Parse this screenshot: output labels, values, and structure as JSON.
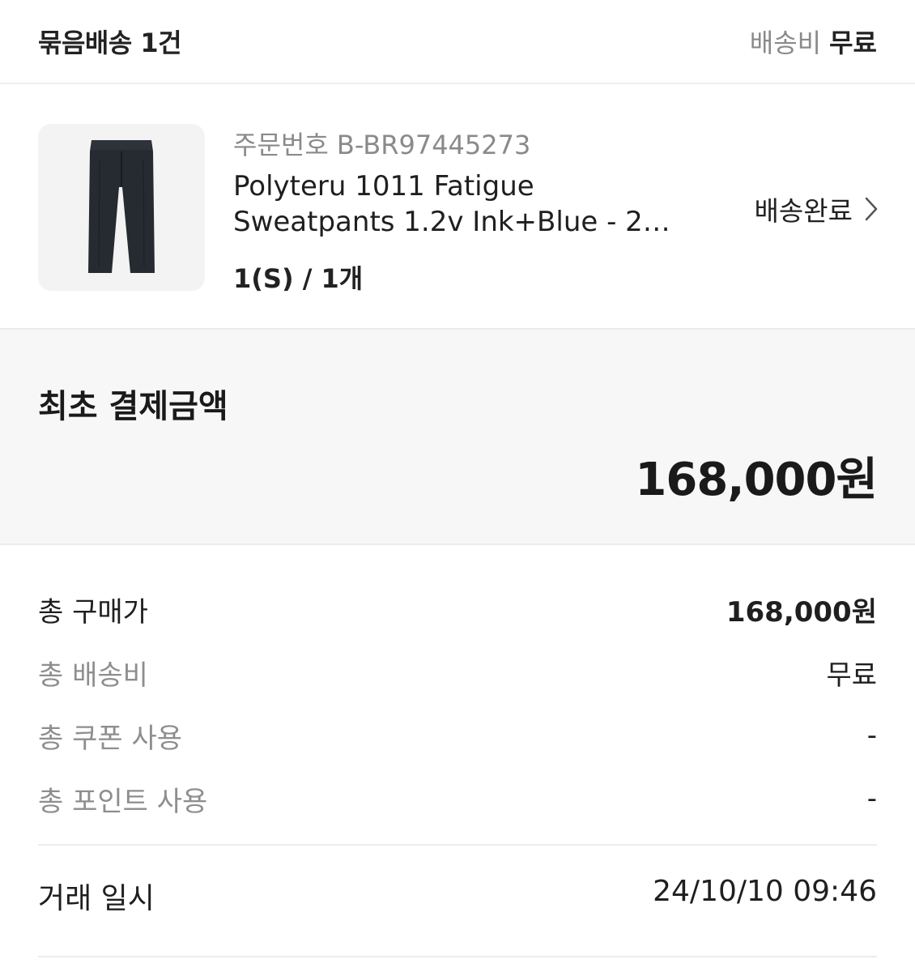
{
  "bundle": {
    "title": "묶음배송 1건",
    "shipping_label": "배송비",
    "shipping_value": "무료"
  },
  "item": {
    "order_number": "주문번호 B-BR97445273",
    "name_line1": "Polyteru 1011 Fatigue",
    "name_line2": "Sweatpants 1.2v Ink+Blue - 2…",
    "option": "1(S) / 1개",
    "status": "배송완료",
    "thumbnail_icon": "pants-image"
  },
  "payment": {
    "title": "최초 결제금액",
    "amount": "168,000원"
  },
  "summary": [
    {
      "key": "총 구매가",
      "value": "168,000원"
    },
    {
      "key": "총 배송비",
      "value": "무료"
    },
    {
      "key": "총 쿠폰 사용",
      "value": "-"
    },
    {
      "key": "총 포인트 사용",
      "value": "-"
    }
  ],
  "transaction": {
    "label": "거래 일시",
    "value": "24/10/10 09:46"
  }
}
